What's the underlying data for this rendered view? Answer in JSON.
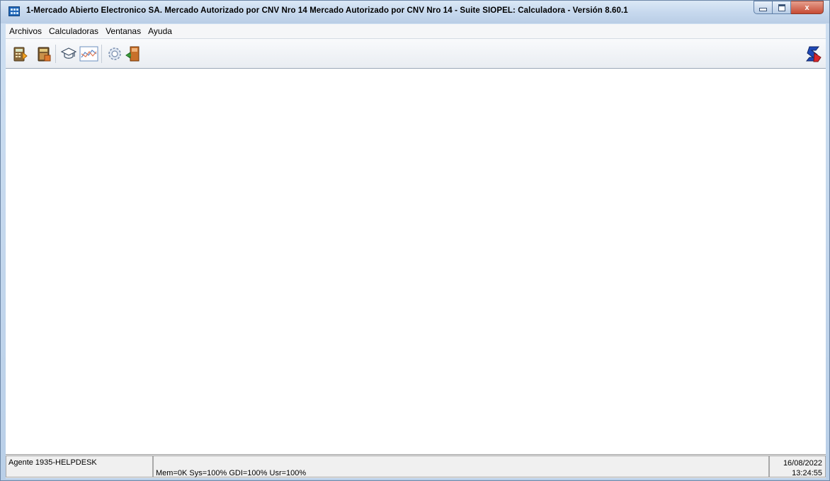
{
  "window": {
    "title": "1-Mercado Abierto Electronico SA. Mercado Autorizado por CNV Nro 14 Mercado Autorizado por CNV Nro 14 - Suite SIOPEL: Calculadora - Versión 8.60.1",
    "buttons": {
      "minimize": "minimize",
      "maximize": "maximize",
      "close": "x"
    }
  },
  "menu": {
    "items": [
      {
        "label": "Archivos"
      },
      {
        "label": "Calculadoras"
      },
      {
        "label": "Ventanas"
      },
      {
        "label": "Ayuda"
      }
    ]
  },
  "toolbar": {
    "buttons": [
      {
        "icon": "calculator-fixed-income-icon"
      },
      {
        "icon": "calculator-book-icon"
      },
      {
        "icon": "graduation-cap-icon"
      },
      {
        "icon": "line-chart-icon"
      },
      {
        "icon": "gear-settings-icon"
      },
      {
        "icon": "exit-door-icon"
      }
    ],
    "logo_icon": "siopel-logo-icon"
  },
  "status": {
    "agent": "Agente 1935-HELPDESK",
    "resources": "Mem=0K Sys=100% GDI=100% Usr=100%",
    "date": "16/08/2022",
    "time": "13:24:55"
  },
  "colors": {
    "frame": "#c4d6ea",
    "client": "#ffffff",
    "statusbar": "#f0f0f0",
    "close_button": "#c64b34"
  }
}
